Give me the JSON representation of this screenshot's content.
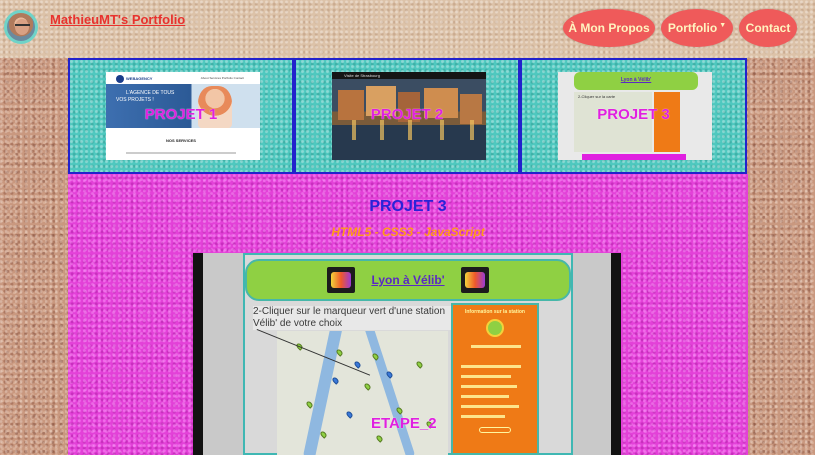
{
  "header": {
    "site_title": "MathieuMT's Portfolio",
    "nav": {
      "about": "À Mon Propos",
      "portfolio": "Portfolio",
      "portfolio_caret": "▼",
      "contact": "Contact"
    }
  },
  "thumbnails": [
    {
      "label": "PROJET 1",
      "mini": {
        "logo": "WEBAGENCY",
        "nav": "About  Services  Portfolio  Contact",
        "hero_line1": "L'AGENCE DE TOUS",
        "hero_line2": "VOS PROJETS !",
        "services": "NOS SERVICES"
      }
    },
    {
      "label": "PROJET 2",
      "mini": {
        "bar": "Visite de Strasbourg"
      }
    },
    {
      "label": "PROJET 3",
      "mini": {
        "title": "Lyon à Vélib'",
        "step": "2-Cliquer sur la carte"
      }
    }
  ],
  "project": {
    "title": "PROJET 3",
    "subtitle": "HTML5 - CSS3 - JavaScript",
    "slide": {
      "app_title": "Lyon à Vélib'",
      "step_text": "2-Cliquer sur le marqueur vert d'une station Vélib' de votre choix",
      "step_label": "ETAPE_2",
      "info_title": "Information sur la station",
      "prev_arrow": "‹",
      "next_arrow": "›"
    }
  },
  "colors": {
    "nav_button": "#ef5a5a",
    "thumb_border": "#2222cc",
    "thumb_bg": "#4fc8bf",
    "panel_bg": "#e341d8",
    "project_title": "#2a22d8",
    "project_subtitle": "#ff9a18",
    "thumb_label": "#e020e0"
  }
}
